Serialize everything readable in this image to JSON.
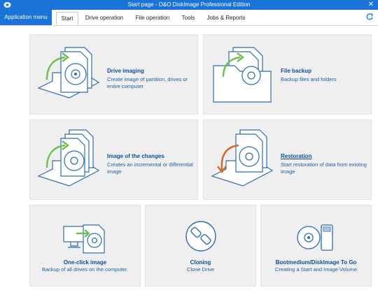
{
  "window": {
    "title": "Start page - O&O DiskImage Professional Edition"
  },
  "ribbon": {
    "app_menu": "Application menu",
    "tabs": [
      {
        "label": "Start",
        "active": true
      },
      {
        "label": "Drive operation"
      },
      {
        "label": "File operation"
      },
      {
        "label": "Tools"
      },
      {
        "label": "Jobs & Reports"
      }
    ]
  },
  "tiles": {
    "drive_imaging": {
      "title": "Drive imaging",
      "desc": "Create image of partition, drives or entire computer"
    },
    "file_backup": {
      "title": "File backup",
      "desc": "Backup files and folders"
    },
    "image_changes": {
      "title": "Image of the changes",
      "desc": "Creates an incremental or differential image"
    },
    "restoration": {
      "title": "Restoration",
      "desc": "Start restoration of data from existing image"
    },
    "one_click": {
      "title": "One-click image",
      "desc": "Backup of all drives on the computer."
    },
    "cloning": {
      "title": "Cloning",
      "desc": "Clone Drive"
    },
    "bootmedium": {
      "title": "Bootmedium/DiskImage To Go",
      "desc": "Creating a Start and Image Volume"
    }
  },
  "colors": {
    "accent": "#1a73d9",
    "icon_blue": "#2a6db5",
    "green": "#6cc04a",
    "orange": "#d46a2a",
    "tile_bg": "#efefef"
  }
}
